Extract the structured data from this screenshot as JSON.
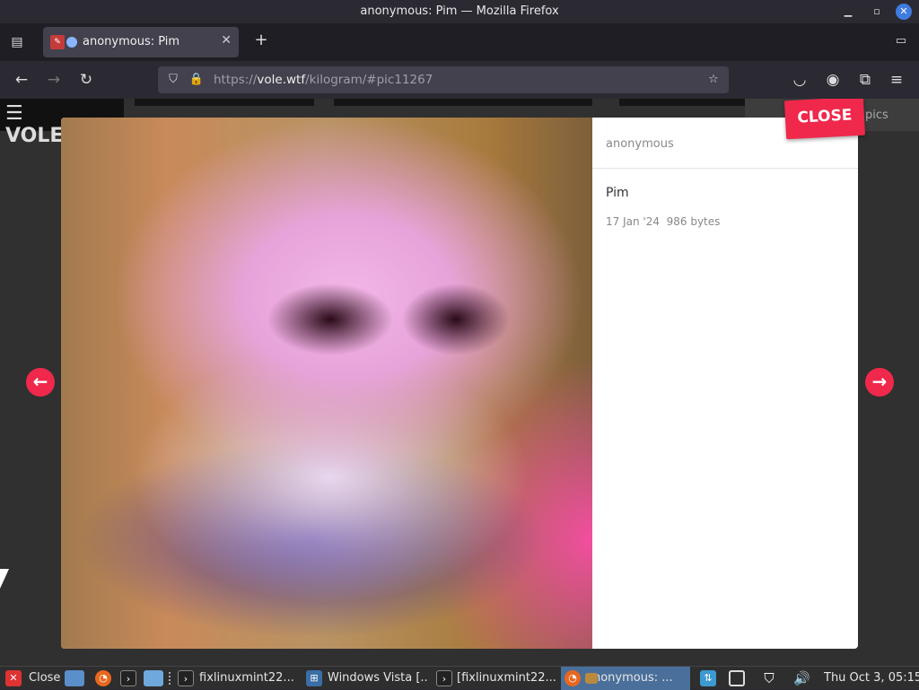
{
  "window": {
    "title": "anonymous: Pim — Mozilla Firefox"
  },
  "tab": {
    "label": "anonymous: Pim",
    "close_glyph": "✕"
  },
  "newtab_glyph": "+",
  "url": {
    "scheme": "https://",
    "host": "vole.wtf",
    "path": "/kilogram/#pic11267"
  },
  "background": {
    "logo": "☰ VOLE.WTF",
    "right_text": "pics"
  },
  "modal": {
    "user": "anonymous",
    "name": "Pim",
    "date": "17 Jan '24",
    "size": "986 bytes",
    "close_label": "CLOSE",
    "prev_glyph": "←",
    "next_glyph": "→"
  },
  "taskbar": {
    "close_label": "Close",
    "items": [
      "fixlinuxmint22...",
      "Windows Vista [...",
      "[fixlinuxmint22...",
      "anonymous: ..."
    ],
    "clock": "Thu Oct  3, 05:15"
  },
  "colors": {
    "accent": "#f0284b",
    "browser_bg": "#2b2a33",
    "urlbar_bg": "#42414d"
  }
}
